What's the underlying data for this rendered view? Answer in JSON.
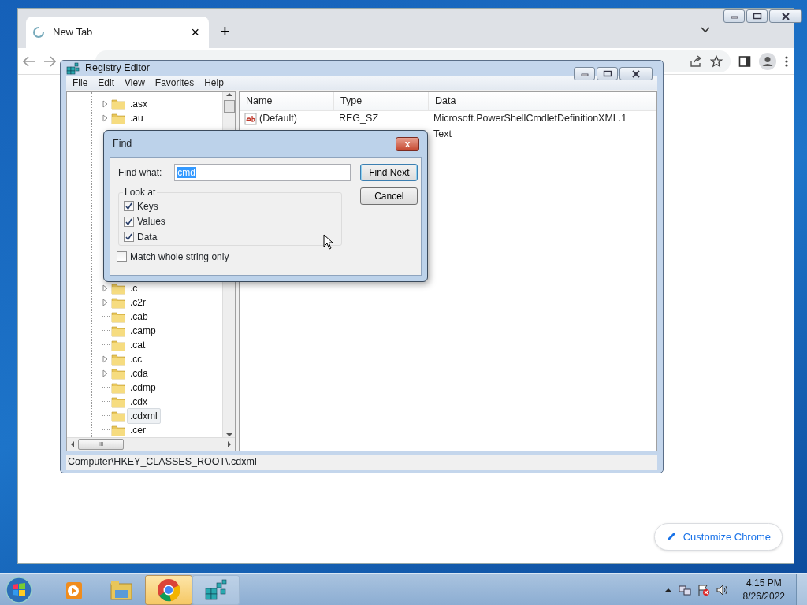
{
  "browser": {
    "tab": {
      "title": "New Tab",
      "close": "×"
    },
    "new_tab": "+",
    "customize": "Customize Chrome"
  },
  "registry_editor": {
    "title": "Registry Editor",
    "menu": [
      "File",
      "Edit",
      "View",
      "Favorites",
      "Help"
    ],
    "tree_groups": [
      {
        "items": [
          {
            "label": ".asx",
            "expandable": true,
            "selected": false
          },
          {
            "label": ".au",
            "expandable": true,
            "selected": false
          }
        ]
      },
      {
        "items": [
          {
            "label": ".c",
            "expandable": true,
            "selected": false
          },
          {
            "label": ".c2r",
            "expandable": true,
            "selected": false
          },
          {
            "label": ".cab",
            "expandable": false,
            "selected": false
          },
          {
            "label": ".camp",
            "expandable": false,
            "selected": false
          },
          {
            "label": ".cat",
            "expandable": false,
            "selected": false
          },
          {
            "label": ".cc",
            "expandable": true,
            "selected": false
          },
          {
            "label": ".cda",
            "expandable": true,
            "selected": false
          },
          {
            "label": ".cdmp",
            "expandable": false,
            "selected": false
          },
          {
            "label": ".cdx",
            "expandable": false,
            "selected": false
          },
          {
            "label": ".cdxml",
            "expandable": false,
            "selected": true
          },
          {
            "label": ".cer",
            "expandable": false,
            "selected": false
          }
        ]
      }
    ],
    "scroll_thumb": "III",
    "columns": [
      "Name",
      "Type",
      "Data"
    ],
    "rows": [
      {
        "name": "(Default)",
        "type": "REG_SZ",
        "data": "Microsoft.PowerShellCmdletDefinitionXML.1"
      },
      {
        "data": "Text"
      }
    ],
    "status": "Computer\\HKEY_CLASSES_ROOT\\.cdxml"
  },
  "find_dialog": {
    "title": "Find",
    "close": "x",
    "find_what_label": "Find what:",
    "find_what": "cmd",
    "look_at": "Look at",
    "options": [
      {
        "label": "Keys",
        "checked": true
      },
      {
        "label": "Values",
        "checked": true
      },
      {
        "label": "Data",
        "checked": true
      }
    ],
    "match_whole": {
      "label": "Match whole string only",
      "checked": false
    },
    "buttons": [
      "Find Next",
      "Cancel"
    ]
  },
  "taskbar": {
    "apps": [
      {
        "kind": "media",
        "selected": false
      },
      {
        "kind": "explorer",
        "selected": false
      },
      {
        "kind": "chrome",
        "selected": true
      },
      {
        "kind": "regedit",
        "selected": false
      }
    ],
    "time": "4:15 PM",
    "date": "8/26/2022"
  }
}
